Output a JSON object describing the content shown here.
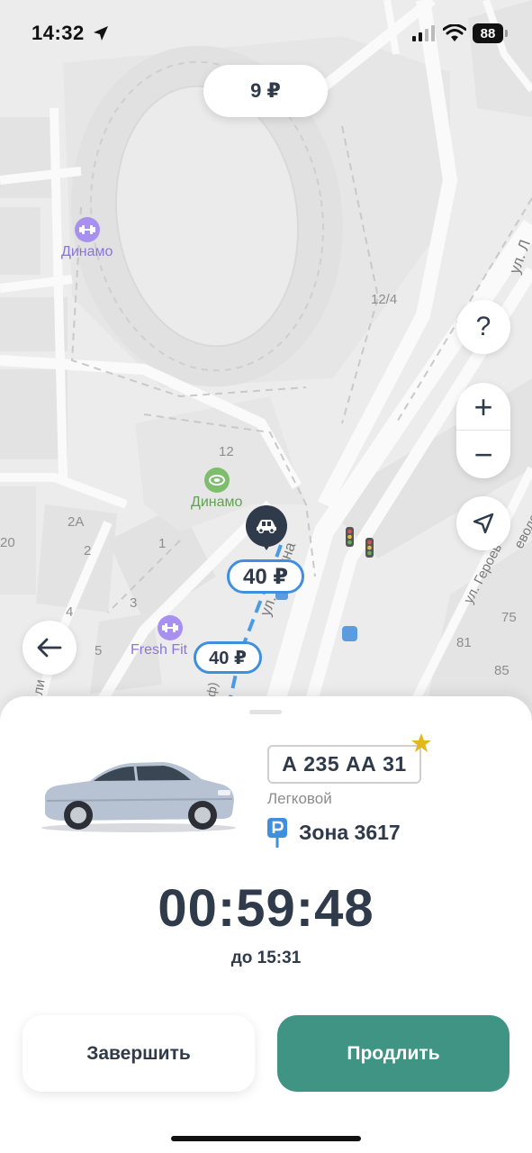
{
  "status_bar": {
    "time": "14:32",
    "battery": "88",
    "icons": [
      "location-arrow-icon",
      "cellular-signal-icon",
      "wifi-icon",
      "battery-icon"
    ]
  },
  "map": {
    "top_price": "9 ₽",
    "labels": {
      "building_12_4": "12/4",
      "building_12": "12",
      "building_2a": "2A",
      "building_1": "1",
      "building_2": "2",
      "building_3": "3",
      "building_4": "4",
      "building_5": "5",
      "building_20": "20",
      "building_75": "75",
      "building_81": "81",
      "building_85": "85",
      "street_lenina": "ул. Ленина",
      "street_top_right": "ул. Л",
      "street_geroev": "ул. Героев",
      "street_evole": "еволе",
      "street_left_fragment": "ли",
      "street_fragment_2": "ф)"
    },
    "poi": {
      "dinamo_gym": "Динамо",
      "dinamo_stadium": "Динамо",
      "fresh_fit": "Fresh Fit"
    },
    "zone_prices": [
      "40 ₽",
      "40 ₽"
    ],
    "controls": {
      "help": "?",
      "zoom_in": "+",
      "zoom_out": "−"
    }
  },
  "vehicle": {
    "plate": "А 235 АА 31",
    "type": "Легковой",
    "zone": "Зона 3617",
    "favorite": true
  },
  "session": {
    "timer": "00:59:48",
    "until": "до 15:31"
  },
  "actions": {
    "finish": "Завершить",
    "extend": "Продлить"
  },
  "colors": {
    "accent_green": "#3f9484",
    "text_dark": "#2f3a4a",
    "zone_blue": "#3f8fdf",
    "star_gold": "#e3b81e"
  }
}
